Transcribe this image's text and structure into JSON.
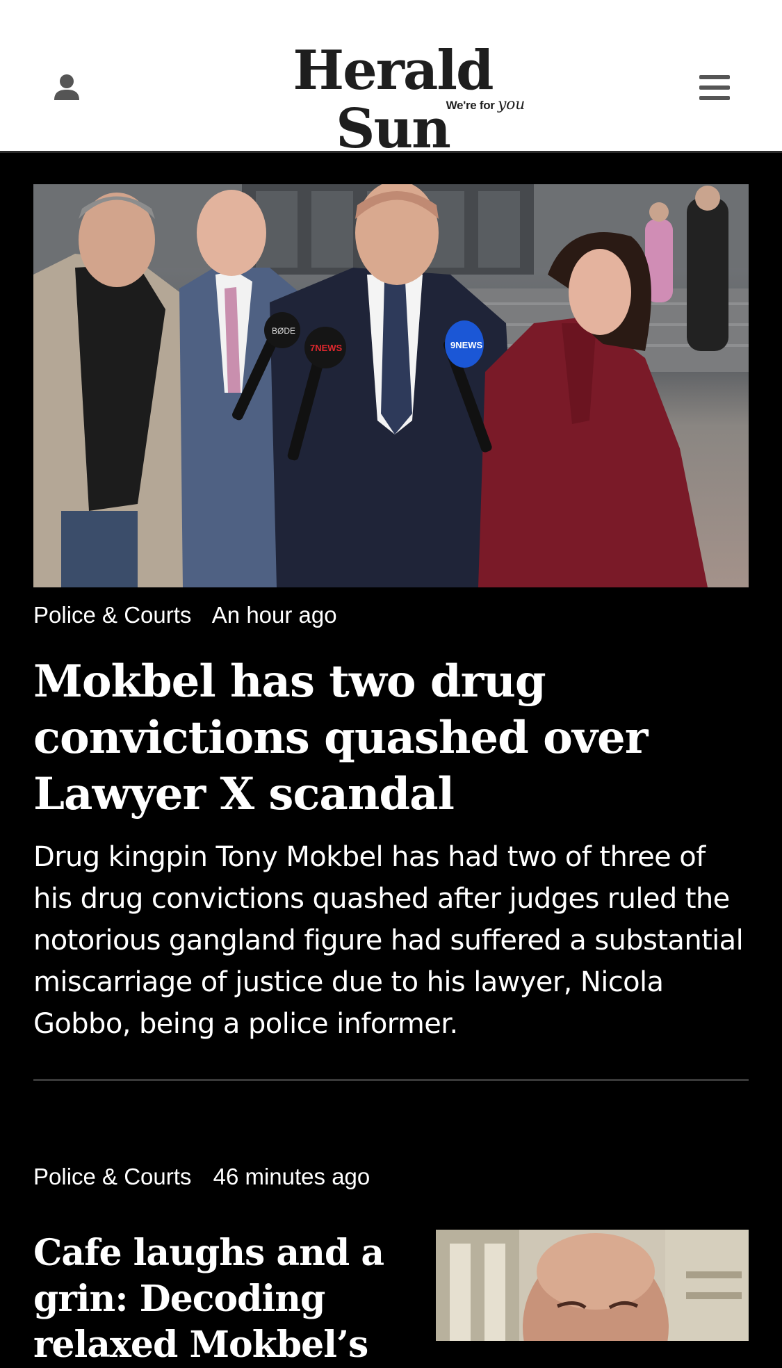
{
  "header": {
    "logo_title": "Herald Sun",
    "logo_tag_prefix": "We're for",
    "logo_tag_script": "you",
    "user_icon": "user-icon",
    "menu_icon": "hamburger-menu-icon"
  },
  "hero": {
    "category": "Police & Courts",
    "time": "An hour ago",
    "headline": "Mokbel has two drug convictions quashed over Lawyer X scandal",
    "standfirst": "Drug kingpin Tony Mokbel has had two of three of his drug convictions quashed after judges ruled the notorious gangland figure had suffered a substantial miscarriage of justice due to his lawyer, Nicola Gobbo, being a police informer.",
    "mic_labels": {
      "left": "BØDE",
      "middle": "7NEWS",
      "right": "9NEWS"
    }
  },
  "second": {
    "category": "Police & Courts",
    "time": "46 minutes ago",
    "headline": "Cafe laughs and a grin: Decoding relaxed Mokbel’s"
  },
  "colors": {
    "background": "#000000",
    "header_bg": "#ffffff",
    "text": "#ffffff",
    "logo": "#1e1e1e",
    "divider": "#3a3a3a"
  }
}
